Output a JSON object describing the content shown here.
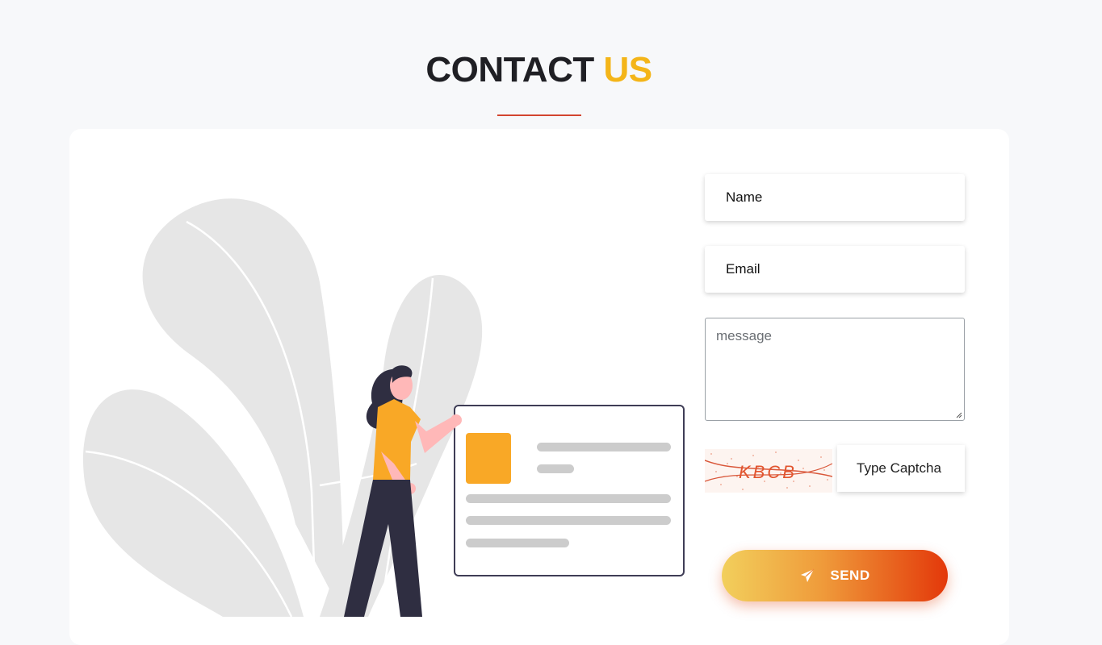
{
  "header": {
    "title_main": "CONTACT",
    "title_accent": "US"
  },
  "form": {
    "name_placeholder": "Name",
    "email_placeholder": "Email",
    "message_placeholder": "message",
    "captcha_text": "KBCB",
    "captcha_placeholder": "Type Captcha",
    "send_label": "SEND"
  },
  "colors": {
    "accent": "#f4b519",
    "underline": "#d2452f",
    "send_gradient_start": "#f2cf5c",
    "send_gradient_end": "#e3380a"
  },
  "icons": {
    "send": "paper-plane-icon"
  }
}
